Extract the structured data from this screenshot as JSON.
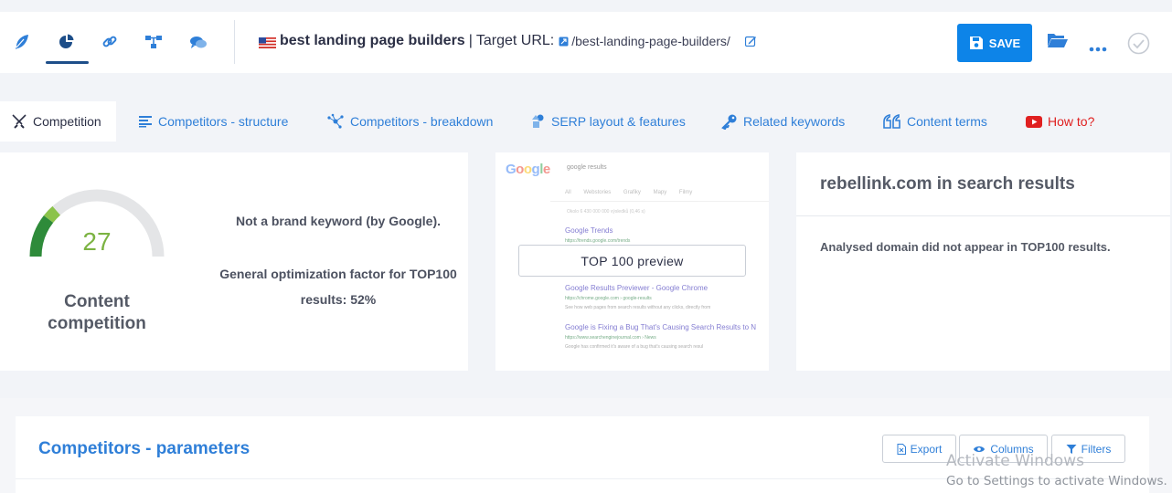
{
  "toolbar": {
    "keyword": "best landing page builders",
    "separator": "|",
    "target_label": "Target URL:",
    "target_url": "/best-landing-page-builders/",
    "save_label": "SAVE",
    "country_flag": "us-flag",
    "icons": [
      "feather-icon",
      "pie-chart-icon",
      "link-icon",
      "structure-icon",
      "chat-icon"
    ]
  },
  "tabs": [
    {
      "label": "Competition",
      "icon": "swords-icon",
      "active": true
    },
    {
      "label": "Competitors - structure",
      "icon": "structure-list-icon"
    },
    {
      "label": "Competitors - breakdown",
      "icon": "network-icon"
    },
    {
      "label": "SERP layout & features",
      "icon": "shapes-icon"
    },
    {
      "label": "Related keywords",
      "icon": "key-icon"
    },
    {
      "label": "Content terms",
      "icon": "quote-icon"
    },
    {
      "label": "How to?",
      "icon": "youtube-icon"
    }
  ],
  "competition": {
    "score": "27",
    "score_fraction": 0.27,
    "label": "Content competition",
    "brand_text": "Not a brand keyword (by Google).",
    "optimization_text": "General optimization factor for TOP100 results: 52%"
  },
  "serp_preview": {
    "button_label": "TOP 100 preview",
    "logo": "Google",
    "query": "google results",
    "tabs_text": "All  Webstories  Grafiky  Mapy  Filmy",
    "meta": "Okolo 6 430 000 000 výsledků (0,46 s)",
    "results": [
      {
        "title": "Google Trends",
        "url": "https://trends.google.com/trends",
        "desc": ""
      },
      {
        "title": "Google Results Previewer - Google Chrome",
        "url": "https://chrome.google.com › google-results",
        "desc": "See how web pages from search results without any clicks, directly from"
      },
      {
        "title": "Google is Fixing a Bug That's Causing Search Results to N",
        "url": "https://www.searchenginejournal.com › News",
        "desc": "Google has confirmed it's aware of a bug that's causing search resul"
      }
    ]
  },
  "domain": {
    "title": "rebellink.com in search results",
    "message": "Analysed domain did not appear in TOP100 results."
  },
  "params": {
    "title": "Competitors - parameters",
    "export_label": "Export",
    "columns_label": "Columns",
    "filters_label": "Filters"
  },
  "windows": {
    "line1": "Activate Windows",
    "line2": "Go to Settings to activate Windows."
  },
  "colors": {
    "accent": "#0d84e8",
    "link": "#2f7fd8",
    "gauge_green": "#7cb342",
    "gauge_dark": "#2e8b3a",
    "howto_red": "#e02020"
  }
}
